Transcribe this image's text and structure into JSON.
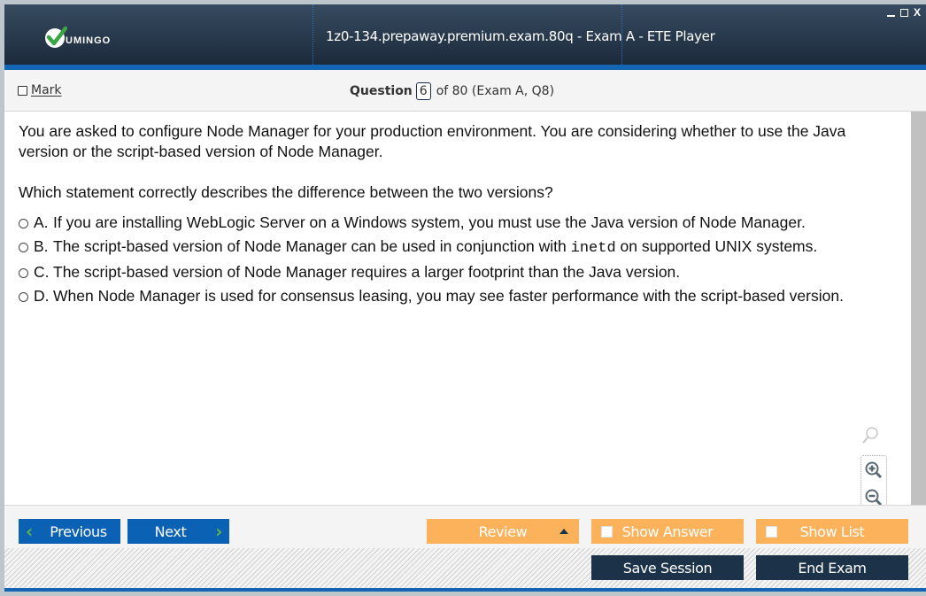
{
  "window": {
    "title": "1z0-134.prepaway.premium.exam.80q - Exam A - ETE Player",
    "logo_text": "UMINGO",
    "controls": {
      "minimize": "minimize",
      "maximize": "maximize",
      "close": "X"
    }
  },
  "header": {
    "mark_label": "Mark",
    "question_label": "Question",
    "question_number": "6",
    "question_of": "of 80 (Exam A, Q8)"
  },
  "question": {
    "stem": "You are asked to configure Node Manager for your production environment. You are considering whether to use the Java version or the script-based version of Node Manager.",
    "prompt": "Which statement correctly describes the difference between the two versions?",
    "options": [
      {
        "letter": "A.",
        "text": "If you are installing WebLogic Server on a Windows system, you must use the Java version of Node Manager."
      },
      {
        "letter": "B.",
        "text_before": "The script-based version of Node Manager can be used in conjunction with ",
        "code": "inetd",
        "text_after": " on supported UNIX systems."
      },
      {
        "letter": "C.",
        "text": "The script-based version of Node Manager requires a larger footprint than the Java version."
      },
      {
        "letter": "D.",
        "text": "When Node Manager is used for consensus leasing, you may see faster performance with the script-based version."
      }
    ]
  },
  "zoom_tools": [
    "magnifier",
    "zoom-in",
    "zoom-out"
  ],
  "nav": {
    "previous": "Previous",
    "next": "Next",
    "review": "Review",
    "show_answer": "Show Answer",
    "show_list": "Show List",
    "save_session": "Save Session",
    "end_exam": "End Exam"
  },
  "colors": {
    "nav_blue": "#0b62b4",
    "orange": "#fbb25b",
    "navy": "#1b3249",
    "accent_green": "#5cb543"
  }
}
